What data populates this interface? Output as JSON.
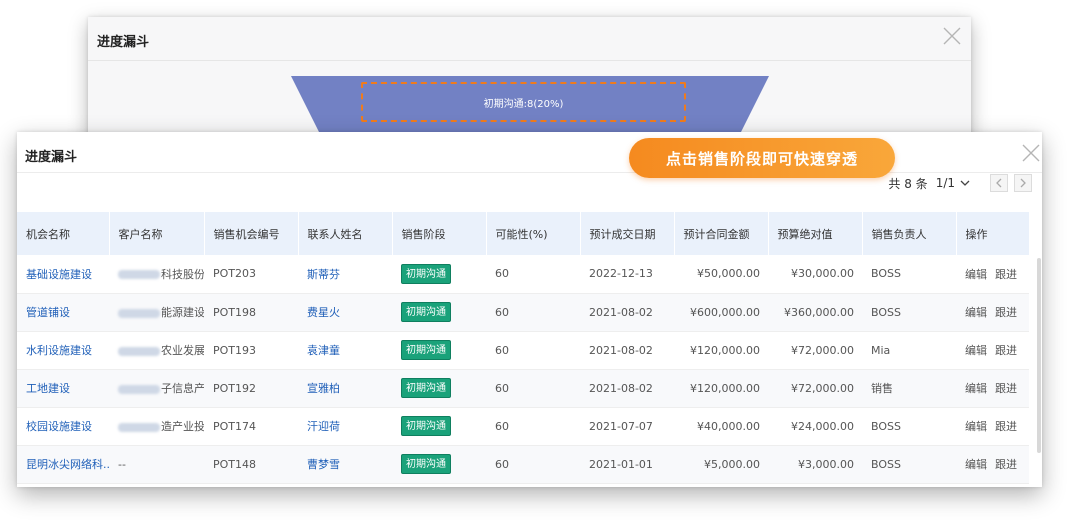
{
  "back_window": {
    "title": "进度漏斗",
    "funnel_label": "初期沟通:8(20%)",
    "funnel_color": "#7281c4"
  },
  "front_window": {
    "title": "进度漏斗",
    "banner": "点击销售阶段即可快速穿透",
    "pager": {
      "total": "共 8 条",
      "page": "1/1"
    }
  },
  "table": {
    "columns": [
      "机会名称",
      "客户名称",
      "销售机会编号",
      "联系人姓名",
      "销售阶段",
      "可能性(%)",
      "预计成交日期",
      "预计合同金额",
      "预算绝对值",
      "销售负责人",
      "操作"
    ],
    "rows": [
      {
        "name": "基础设施建设",
        "customer": "科技股份有...",
        "code": "POT203",
        "contact": "斯蒂芬",
        "stage": "初期沟通",
        "prob": "60",
        "date": "2022-12-13",
        "amount": "¥50,000.00",
        "budget": "¥30,000.00",
        "owner": "BOSS"
      },
      {
        "name": "管道铺设",
        "customer": "能源建设集...",
        "code": "POT198",
        "contact": "费星火",
        "stage": "初期沟通",
        "prob": "60",
        "date": "2021-08-02",
        "amount": "¥600,000.00",
        "budget": "¥360,000.00",
        "owner": "BOSS"
      },
      {
        "name": "水利设施建设",
        "customer": "农业发展银...",
        "code": "POT193",
        "contact": "袁津童",
        "stage": "初期沟通",
        "prob": "60",
        "date": "2021-08-02",
        "amount": "¥120,000.00",
        "budget": "¥72,000.00",
        "owner": "Mia"
      },
      {
        "name": "工地建设",
        "customer": "子信息产...",
        "code": "POT192",
        "contact": "宣雅柏",
        "stage": "初期沟通",
        "prob": "60",
        "date": "2021-08-02",
        "amount": "¥120,000.00",
        "budget": "¥72,000.00",
        "owner": "销售"
      },
      {
        "name": "校园设施建设",
        "customer": "造产业投...",
        "code": "POT174",
        "contact": "汗迎荷",
        "stage": "初期沟通",
        "prob": "60",
        "date": "2021-07-07",
        "amount": "¥40,000.00",
        "budget": "¥24,000.00",
        "owner": "BOSS"
      },
      {
        "name": "昆明冰尖网络科...",
        "customer": "--",
        "code": "POT148",
        "contact": "曹梦雪",
        "stage": "初期沟通",
        "prob": "60",
        "date": "2021-01-01",
        "amount": "¥5,000.00",
        "budget": "¥3,000.00",
        "owner": "BOSS"
      }
    ],
    "actions": {
      "edit": "编辑",
      "follow": "跟进"
    }
  },
  "colors": {
    "accent": "#f58a1f",
    "link": "#1f5fb8",
    "stage_tag": "#1aa27a",
    "header_bg": "#eaf1fb"
  }
}
